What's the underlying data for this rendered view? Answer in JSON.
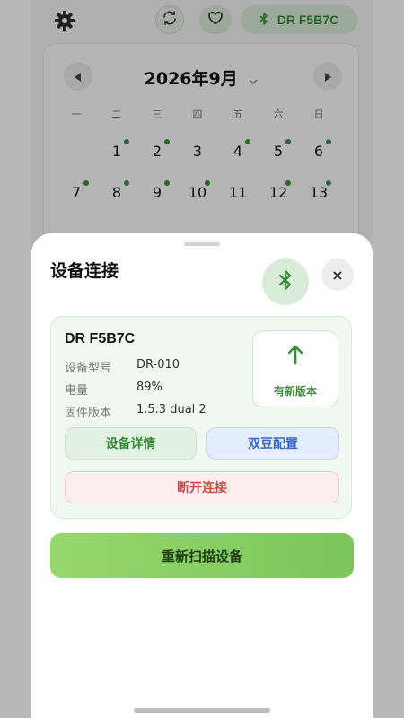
{
  "device_pill": {
    "label": "DR F5B7C"
  },
  "calendar": {
    "title": "2026年9月",
    "weekdays": [
      "一",
      "二",
      "三",
      "四",
      "五",
      "六",
      "日"
    ],
    "days": [
      {
        "d": "1",
        "col": 1,
        "row": 0,
        "dot": true
      },
      {
        "d": "2",
        "col": 2,
        "row": 0,
        "dot": true
      },
      {
        "d": "3",
        "col": 3,
        "row": 0,
        "dot": false
      },
      {
        "d": "4",
        "col": 4,
        "row": 0,
        "dot": true
      },
      {
        "d": "5",
        "col": 5,
        "row": 0,
        "dot": true
      },
      {
        "d": "6",
        "col": 6,
        "row": 0,
        "dot": true
      },
      {
        "d": "7",
        "col": 0,
        "row": 1,
        "dot": true
      },
      {
        "d": "8",
        "col": 1,
        "row": 1,
        "dot": true
      },
      {
        "d": "9",
        "col": 2,
        "row": 1,
        "dot": true
      },
      {
        "d": "10",
        "col": 3,
        "row": 1,
        "dot": true
      },
      {
        "d": "11",
        "col": 4,
        "row": 1,
        "dot": false
      },
      {
        "d": "12",
        "col": 5,
        "row": 1,
        "dot": true
      },
      {
        "d": "13",
        "col": 6,
        "row": 1,
        "dot": true
      }
    ]
  },
  "sheet": {
    "title": "设备连接",
    "close_label": "×",
    "device": {
      "name": "DR F5B7C",
      "rows": [
        {
          "label": "设备型号",
          "value": "DR-010"
        },
        {
          "label": "电量",
          "value": "89%"
        },
        {
          "label": "固件版本",
          "value": "1.5.3 dual 2"
        }
      ],
      "update_label": "有新版本",
      "detail_label": "设备详情",
      "config_label": "双豆配置",
      "disconnect_label": "断开连接"
    },
    "rescan_label": "重新扫描设备"
  },
  "colors": {
    "accent_green": "#3a8a3a",
    "danger_red": "#d14a4a",
    "info_blue": "#3a68c4"
  }
}
